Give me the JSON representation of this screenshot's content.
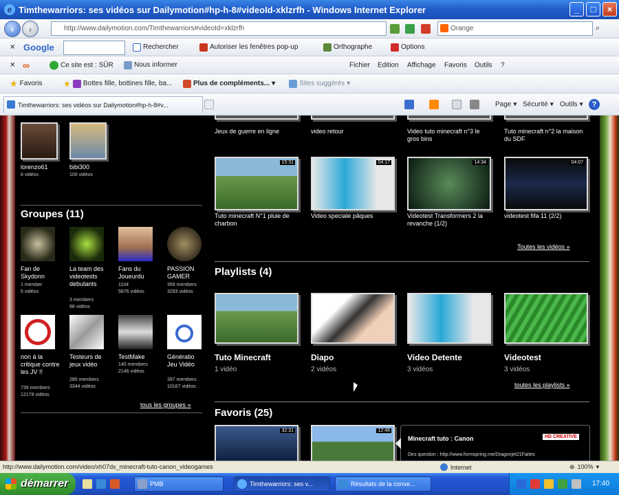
{
  "window": {
    "title": "Timthewarriors: ses vidéos sur Dailymotion#hp-h-8#videoId-xklzrfh - Windows Internet Explorer"
  },
  "address": {
    "url": "http://www.dailymotion.com/Timthewarriors#videoId=xklzrfh",
    "search_placeholder": "Orange"
  },
  "toolbar_google": {
    "brand": "Google",
    "search_label": "Rechercher",
    "popup_label": "Autoriser les fenêtres pop-up",
    "spell_label": "Orthographe",
    "options_label": "Options"
  },
  "toolbar_safe": {
    "safe_label": "Ce site est : SÛR",
    "inform_label": "Nous informer"
  },
  "menu": [
    "Fichier",
    "Edition",
    "Affichage",
    "Favoris",
    "Outils",
    "?"
  ],
  "favbar": {
    "favorites": "Favoris",
    "link1": "Bottes fille, bottines fille, ba...",
    "more": "Plus de compléments...",
    "suggested": "Sites suggérés"
  },
  "tab": {
    "label": "Timthewarriors: ses vidéos sur Dailymotion#hp-h-8#v..."
  },
  "cmdbar": {
    "page": "Page",
    "security": "Sécurité",
    "tools": "Outils"
  },
  "friends": [
    {
      "name": "lorenzo61",
      "stat": "8 vidéos"
    },
    {
      "name": "bibi300",
      "stat": "100 vidéos"
    }
  ],
  "groups_title": "Groupes (11)",
  "groups": [
    {
      "name": "Fan de Skydonn",
      "l1": "1 member",
      "l2": "5 vidéos"
    },
    {
      "name": "La team des videotests debutants",
      "l1": "3 members",
      "l2": "98 vidéos"
    },
    {
      "name": "Fans du Joueurdu",
      "l1": "1104",
      "l2": "5876 vidéos"
    },
    {
      "name": "PASSION GAMER",
      "l1": "359 members",
      "l2": "3293 vidéos"
    },
    {
      "name": "non à la critique contre les JV !!",
      "l1": "739 members",
      "l2": "12178 vidéos"
    },
    {
      "name": "Testeurs de jeux vidéo",
      "l1": "280 members",
      "l2": "3344 vidéos"
    },
    {
      "name": "TestMake",
      "l1": "140 members",
      "l2": "2146 vidéos"
    },
    {
      "name": "Génératio Jeu Vidéo",
      "l1": "397 members",
      "l2": "10167 vidéos"
    }
  ],
  "all_groups": "tous les groupes »",
  "videos_top": [
    {
      "title": "Jeux de guerre en ligne"
    },
    {
      "title": "video retour"
    },
    {
      "title": "Video tuto minecraft n°3 le gros bins"
    },
    {
      "title": "Tuto minecraft n°2 la maison du SDF"
    }
  ],
  "videos": [
    {
      "title": "Tuto minecraft N°1 pluie de charbon",
      "dur": "15:31"
    },
    {
      "title": "Video speciale pâques",
      "dur": "04:17"
    },
    {
      "title": "Videotest Transformers 2 la revanche (1/2)",
      "dur": "14:34"
    },
    {
      "title": "videotest fifa 11 (2/2)",
      "dur": "04:07"
    }
  ],
  "all_videos": "Toutes les vidéos »",
  "playlists_title": "Playlists (4)",
  "playlists": [
    {
      "name": "Tuto Minecraft",
      "count": "1 vidéo"
    },
    {
      "name": "Diapo",
      "count": "2 vidéos"
    },
    {
      "name": "Video Detente",
      "count": "3 vidéos"
    },
    {
      "name": "Videotest",
      "count": "3 vidéos"
    }
  ],
  "all_playlists": "toutes les playlists »",
  "favorites_title": "Favoris (25)",
  "favorites": [
    {
      "dur": "32:31"
    },
    {
      "dur": "12:48"
    }
  ],
  "fav_panel": {
    "title": "Minecraft tuto : Canon",
    "desc": "Des question : http://www.formspring.me/Dragonjet21Faites",
    "badge": "HD CREATIVE"
  },
  "status": {
    "url": "http://www.dailymotion.com/video/xh07dx_minecraft-tuto-canon_videogames",
    "zone": "Internet",
    "zoom": "100%"
  },
  "taskbar": {
    "start": "démarrer",
    "buttons": [
      "PMB",
      "Timthewarriors: ses v...",
      "Résultats de la conve..."
    ],
    "clock": "17:40"
  }
}
